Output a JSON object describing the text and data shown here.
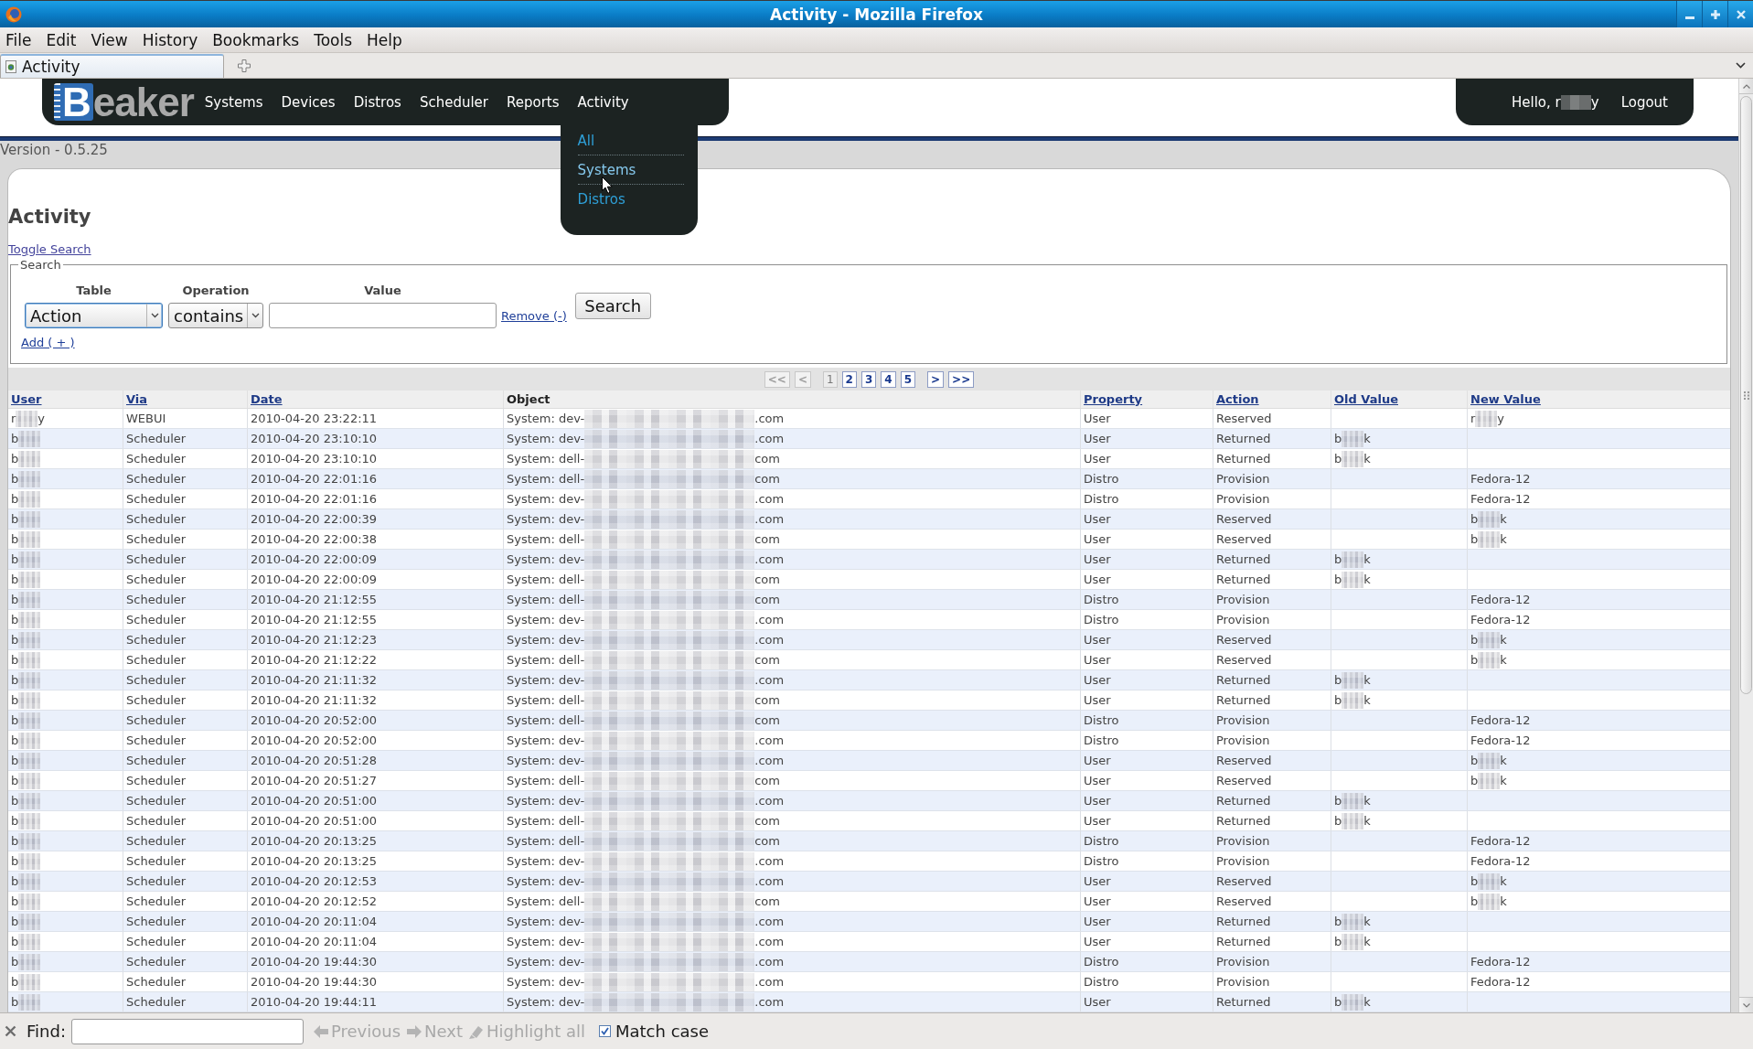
{
  "window": {
    "title": "Activity - Mozilla Firefox"
  },
  "menu_bar": [
    "File",
    "Edit",
    "View",
    "History",
    "Bookmarks",
    "Tools",
    "Help"
  ],
  "tabs": [
    {
      "label": "Activity",
      "selected": true
    }
  ],
  "header": {
    "logo": "Beaker",
    "nav": [
      {
        "label": "Systems"
      },
      {
        "label": "Devices"
      },
      {
        "label": "Distros"
      },
      {
        "label": "Scheduler"
      },
      {
        "label": "Reports"
      },
      {
        "label": "Activity",
        "submenu": [
          {
            "label": "All",
            "hovered": false
          },
          {
            "label": "Systems",
            "hovered": true
          },
          {
            "label": "Distros",
            "hovered": false
          }
        ]
      }
    ],
    "greeting": {
      "before": "Hello, r",
      "after": "y"
    },
    "logout": "Logout"
  },
  "version": "Version - 0.5.25",
  "heading": "Activity",
  "toggle_search": "Toggle Search",
  "search": {
    "legend": "Search",
    "labels": [
      "Table",
      "Operation",
      "Value"
    ],
    "filters": [
      {
        "table": {
          "value": "Action",
          "focused": true
        },
        "operation": {
          "value": "contains",
          "focused": false
        },
        "remove": "Remove (-)"
      }
    ],
    "add": "Add ( + )",
    "button": "Search"
  },
  "pagination": [
    {
      "items": [
        {
          "label": "<<",
          "selected": false,
          "disabled": true
        },
        {
          "label": "<",
          "selected": false,
          "disabled": true
        }
      ]
    },
    {
      "items": [
        {
          "label": "1",
          "selected": true,
          "disabled": false
        },
        {
          "label": "2",
          "selected": false,
          "disabled": false
        },
        {
          "label": "3",
          "selected": false,
          "disabled": false
        },
        {
          "label": "4",
          "selected": false,
          "disabled": false
        },
        {
          "label": "5",
          "selected": false,
          "disabled": false
        }
      ]
    },
    {
      "items": [
        {
          "label": ">",
          "selected": false,
          "disabled": false
        },
        {
          "label": ">>",
          "selected": false,
          "disabled": false
        }
      ]
    }
  ],
  "table": {
    "columns": [
      {
        "label": "User",
        "sortable": true
      },
      {
        "label": "Via",
        "sortable": true
      },
      {
        "label": "Date",
        "sortable": true
      },
      {
        "label": "Object",
        "sortable": false
      },
      {
        "label": "Property",
        "sortable": true
      },
      {
        "label": "Action",
        "sortable": true
      },
      {
        "label": "Old Value",
        "sortable": true
      },
      {
        "label": "New Value",
        "sortable": true
      }
    ],
    "rows": [
      {
        "user": {
          "before": "r",
          "after": "y"
        },
        "via": "WEBUI",
        "date": "2010-04-20 23:22:11",
        "object": {
          "before": "System: dev-",
          "after": ".com"
        },
        "property": "User",
        "action": "Reserved",
        "new_value": {
          "before": "r",
          "after": "y"
        }
      },
      {
        "user": {
          "before": "b"
        },
        "via": "Scheduler",
        "date": "2010-04-20 23:10:10",
        "object": {
          "before": "System: dev-",
          "after": ".com"
        },
        "property": "User",
        "action": "Returned",
        "old_value": {
          "before": "b",
          "after": "k"
        }
      },
      {
        "user": {
          "before": "b"
        },
        "via": "Scheduler",
        "date": "2010-04-20 23:10:10",
        "object": {
          "before": "System: dell-",
          "after": "com"
        },
        "property": "User",
        "action": "Returned",
        "old_value": {
          "before": "b",
          "after": "k"
        }
      },
      {
        "user": {
          "before": "b"
        },
        "via": "Scheduler",
        "date": "2010-04-20 22:01:16",
        "object": {
          "before": "System: dell-",
          "after": "com"
        },
        "property": "Distro",
        "action": "Provision",
        "new_value": "Fedora-12"
      },
      {
        "user": {
          "before": "b"
        },
        "via": "Scheduler",
        "date": "2010-04-20 22:01:16",
        "object": {
          "before": "System: dev-",
          "after": ".com"
        },
        "property": "Distro",
        "action": "Provision",
        "new_value": "Fedora-12"
      },
      {
        "user": {
          "before": "b"
        },
        "via": "Scheduler",
        "date": "2010-04-20 22:00:39",
        "object": {
          "before": "System: dev-",
          "after": ".com"
        },
        "property": "User",
        "action": "Reserved",
        "new_value": {
          "before": "b",
          "after": "k"
        }
      },
      {
        "user": {
          "before": "b"
        },
        "via": "Scheduler",
        "date": "2010-04-20 22:00:38",
        "object": {
          "before": "System: dell-",
          "after": "com"
        },
        "property": "User",
        "action": "Reserved",
        "new_value": {
          "before": "b",
          "after": "k"
        }
      },
      {
        "user": {
          "before": "b"
        },
        "via": "Scheduler",
        "date": "2010-04-20 22:00:09",
        "object": {
          "before": "System: dev-",
          "after": ".com"
        },
        "property": "User",
        "action": "Returned",
        "old_value": {
          "before": "b",
          "after": "k"
        }
      },
      {
        "user": {
          "before": "b"
        },
        "via": "Scheduler",
        "date": "2010-04-20 22:00:09",
        "object": {
          "before": "System: dell-",
          "after": "com"
        },
        "property": "User",
        "action": "Returned",
        "old_value": {
          "before": "b",
          "after": "k"
        }
      },
      {
        "user": {
          "before": "b"
        },
        "via": "Scheduler",
        "date": "2010-04-20 21:12:55",
        "object": {
          "before": "System: dell-",
          "after": "com"
        },
        "property": "Distro",
        "action": "Provision",
        "new_value": "Fedora-12"
      },
      {
        "user": {
          "before": "b"
        },
        "via": "Scheduler",
        "date": "2010-04-20 21:12:55",
        "object": {
          "before": "System: dev-",
          "after": ".com"
        },
        "property": "Distro",
        "action": "Provision",
        "new_value": "Fedora-12"
      },
      {
        "user": {
          "before": "b"
        },
        "via": "Scheduler",
        "date": "2010-04-20 21:12:23",
        "object": {
          "before": "System: dev-",
          "after": ".com"
        },
        "property": "User",
        "action": "Reserved",
        "new_value": {
          "before": "b",
          "after": "k"
        }
      },
      {
        "user": {
          "before": "b"
        },
        "via": "Scheduler",
        "date": "2010-04-20 21:12:22",
        "object": {
          "before": "System: dell-",
          "after": "com"
        },
        "property": "User",
        "action": "Reserved",
        "new_value": {
          "before": "b",
          "after": "k"
        }
      },
      {
        "user": {
          "before": "b"
        },
        "via": "Scheduler",
        "date": "2010-04-20 21:11:32",
        "object": {
          "before": "System: dev-",
          "after": ".com"
        },
        "property": "User",
        "action": "Returned",
        "old_value": {
          "before": "b",
          "after": "k"
        }
      },
      {
        "user": {
          "before": "b"
        },
        "via": "Scheduler",
        "date": "2010-04-20 21:11:32",
        "object": {
          "before": "System: dell-",
          "after": "com"
        },
        "property": "User",
        "action": "Returned",
        "old_value": {
          "before": "b",
          "after": "k"
        }
      },
      {
        "user": {
          "before": "b"
        },
        "via": "Scheduler",
        "date": "2010-04-20 20:52:00",
        "object": {
          "before": "System: dell-",
          "after": "com"
        },
        "property": "Distro",
        "action": "Provision",
        "new_value": "Fedora-12"
      },
      {
        "user": {
          "before": "b"
        },
        "via": "Scheduler",
        "date": "2010-04-20 20:52:00",
        "object": {
          "before": "System: dev-",
          "after": ".com"
        },
        "property": "Distro",
        "action": "Provision",
        "new_value": "Fedora-12"
      },
      {
        "user": {
          "before": "b"
        },
        "via": "Scheduler",
        "date": "2010-04-20 20:51:28",
        "object": {
          "before": "System: dev-",
          "after": ".com"
        },
        "property": "User",
        "action": "Reserved",
        "new_value": {
          "before": "b",
          "after": "k"
        }
      },
      {
        "user": {
          "before": "b"
        },
        "via": "Scheduler",
        "date": "2010-04-20 20:51:27",
        "object": {
          "before": "System: dell-",
          "after": "com"
        },
        "property": "User",
        "action": "Reserved",
        "new_value": {
          "before": "b",
          "after": "k"
        }
      },
      {
        "user": {
          "before": "b"
        },
        "via": "Scheduler",
        "date": "2010-04-20 20:51:00",
        "object": {
          "before": "System: dev-",
          "after": ".com"
        },
        "property": "User",
        "action": "Returned",
        "old_value": {
          "before": "b",
          "after": "k"
        }
      },
      {
        "user": {
          "before": "b"
        },
        "via": "Scheduler",
        "date": "2010-04-20 20:51:00",
        "object": {
          "before": "System: dell-",
          "after": "com"
        },
        "property": "User",
        "action": "Returned",
        "old_value": {
          "before": "b",
          "after": "k"
        }
      },
      {
        "user": {
          "before": "b"
        },
        "via": "Scheduler",
        "date": "2010-04-20 20:13:25",
        "object": {
          "before": "System: dell-",
          "after": "com"
        },
        "property": "Distro",
        "action": "Provision",
        "new_value": "Fedora-12"
      },
      {
        "user": {
          "before": "b"
        },
        "via": "Scheduler",
        "date": "2010-04-20 20:13:25",
        "object": {
          "before": "System: dev-",
          "after": ".com"
        },
        "property": "Distro",
        "action": "Provision",
        "new_value": "Fedora-12"
      },
      {
        "user": {
          "before": "b"
        },
        "via": "Scheduler",
        "date": "2010-04-20 20:12:53",
        "object": {
          "before": "System: dev-",
          "after": ".com"
        },
        "property": "User",
        "action": "Reserved",
        "new_value": {
          "before": "b",
          "after": "k"
        }
      },
      {
        "user": {
          "before": "b"
        },
        "via": "Scheduler",
        "date": "2010-04-20 20:12:52",
        "object": {
          "before": "System: dell-",
          "after": "com"
        },
        "property": "User",
        "action": "Reserved",
        "new_value": {
          "before": "b",
          "after": "k"
        }
      },
      {
        "user": {
          "before": "b"
        },
        "via": "Scheduler",
        "date": "2010-04-20 20:11:04",
        "object": {
          "before": "System: dev-",
          "after": ".com"
        },
        "property": "User",
        "action": "Returned",
        "old_value": {
          "before": "b",
          "after": "k"
        }
      },
      {
        "user": {
          "before": "b"
        },
        "via": "Scheduler",
        "date": "2010-04-20 20:11:04",
        "object": {
          "before": "System: dev-",
          "after": ".com"
        },
        "property": "User",
        "action": "Returned",
        "old_value": {
          "before": "b",
          "after": "k"
        }
      },
      {
        "user": {
          "before": "b"
        },
        "via": "Scheduler",
        "date": "2010-04-20 19:44:30",
        "object": {
          "before": "System: dev-",
          "after": ".com"
        },
        "property": "Distro",
        "action": "Provision",
        "new_value": "Fedora-12"
      },
      {
        "user": {
          "before": "b"
        },
        "via": "Scheduler",
        "date": "2010-04-20 19:44:30",
        "object": {
          "before": "System: dev-",
          "after": ".com"
        },
        "property": "Distro",
        "action": "Provision",
        "new_value": "Fedora-12"
      },
      {
        "user": {
          "before": "b"
        },
        "via": "Scheduler",
        "date": "2010-04-20 19:44:11",
        "object": {
          "before": "System: dev-",
          "after": ".com"
        },
        "property": "User",
        "action": "Returned",
        "old_value": {
          "before": "b",
          "after": "k"
        }
      }
    ]
  },
  "find_bar": {
    "label": "Find:",
    "buttons": [
      {
        "label": "Previous",
        "kind": "previous",
        "disabled": true
      },
      {
        "label": "Next",
        "kind": "next",
        "disabled": true
      },
      {
        "label": "Highlight all",
        "kind": "highlight",
        "disabled": true
      }
    ],
    "match_case": {
      "label": "Match case",
      "checked": true
    }
  }
}
